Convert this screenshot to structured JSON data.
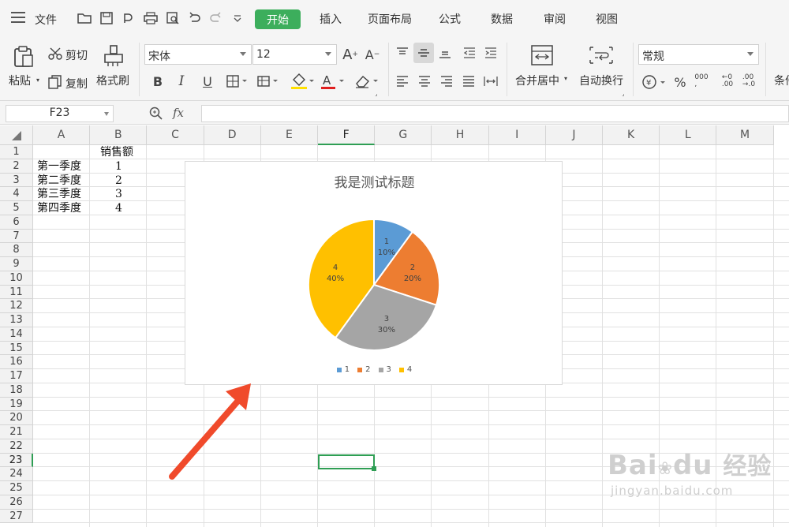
{
  "menubar": {
    "file_label": "文件",
    "tabs": [
      "开始",
      "插入",
      "页面布局",
      "公式",
      "数据",
      "审阅",
      "视图"
    ],
    "active_tab": "开始"
  },
  "ribbon": {
    "paste_label": "粘贴",
    "cut_label": "剪切",
    "copy_label": "复制",
    "format_painter_label": "格式刷",
    "font_name": "宋体",
    "font_size": "12",
    "merge_label": "合并居中",
    "wrap_label": "自动换行",
    "number_format": "常规",
    "cond_format_label": "条件"
  },
  "formula_bar": {
    "name_box": "F23",
    "fx_label": "fx",
    "value": ""
  },
  "grid": {
    "columns": [
      "A",
      "B",
      "C",
      "D",
      "E",
      "F",
      "G",
      "H",
      "I",
      "J",
      "K",
      "L",
      "M"
    ],
    "rows": [
      "1",
      "2",
      "3",
      "4",
      "5",
      "6",
      "7",
      "8",
      "9",
      "10",
      "11",
      "12",
      "13",
      "14",
      "15",
      "16",
      "17",
      "18",
      "19",
      "20",
      "21",
      "22",
      "23",
      "24",
      "25",
      "26",
      "27"
    ],
    "selected_cell": "F23",
    "header_b": "销售额",
    "data": [
      {
        "label": "第一季度",
        "value": "1"
      },
      {
        "label": "第二季度",
        "value": "2"
      },
      {
        "label": "第三季度",
        "value": "3"
      },
      {
        "label": "第四季度",
        "value": "4"
      }
    ]
  },
  "chart_data": {
    "type": "pie",
    "title": "我是测试标题",
    "categories": [
      "1",
      "2",
      "3",
      "4"
    ],
    "values": [
      1,
      2,
      3,
      4
    ],
    "percent_labels": [
      "10%",
      "20%",
      "30%",
      "40%"
    ],
    "colors": [
      "#5b9bd5",
      "#ed7d31",
      "#a5a5a5",
      "#ffc000"
    ],
    "legend": "bottom"
  },
  "watermark": {
    "brand": "Bai",
    "brand2": "du",
    "cn": "经验",
    "url": "jingyan.baidu.com"
  },
  "colors": {
    "accent": "#3cae5c",
    "arrow": "#f04a2b"
  }
}
